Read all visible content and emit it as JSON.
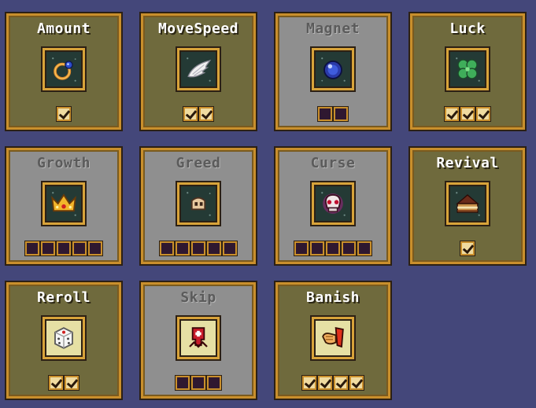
{
  "powerups": [
    {
      "name": "Amount",
      "active": true,
      "ranks": [
        true
      ]
    },
    {
      "name": "MoveSpeed",
      "active": true,
      "ranks": [
        true,
        true
      ]
    },
    {
      "name": "Magnet",
      "active": false,
      "ranks": [
        false,
        false
      ]
    },
    {
      "name": "Luck",
      "active": true,
      "ranks": [
        true,
        true,
        true
      ]
    },
    {
      "name": "Growth",
      "active": false,
      "ranks": [
        false,
        false,
        false,
        false,
        false
      ]
    },
    {
      "name": "Greed",
      "active": false,
      "ranks": [
        false,
        false,
        false,
        false,
        false
      ]
    },
    {
      "name": "Curse",
      "active": false,
      "ranks": [
        false,
        false,
        false,
        false,
        false
      ]
    },
    {
      "name": "Revival",
      "active": true,
      "ranks": [
        true
      ]
    },
    {
      "name": "Reroll",
      "active": true,
      "ranks": [
        true,
        true
      ]
    },
    {
      "name": "Skip",
      "active": false,
      "ranks": [
        false,
        false,
        false
      ]
    },
    {
      "name": "Banish",
      "active": true,
      "ranks": [
        true,
        true,
        true,
        true
      ]
    }
  ],
  "icons": [
    "ring-icon",
    "wing-icon",
    "orb-icon",
    "clover-icon",
    "crown-icon",
    "coin-bag-icon",
    "skull-icon",
    "cake-icon",
    "dice-icon",
    "skip-arrow-icon",
    "banish-hand-icon"
  ]
}
